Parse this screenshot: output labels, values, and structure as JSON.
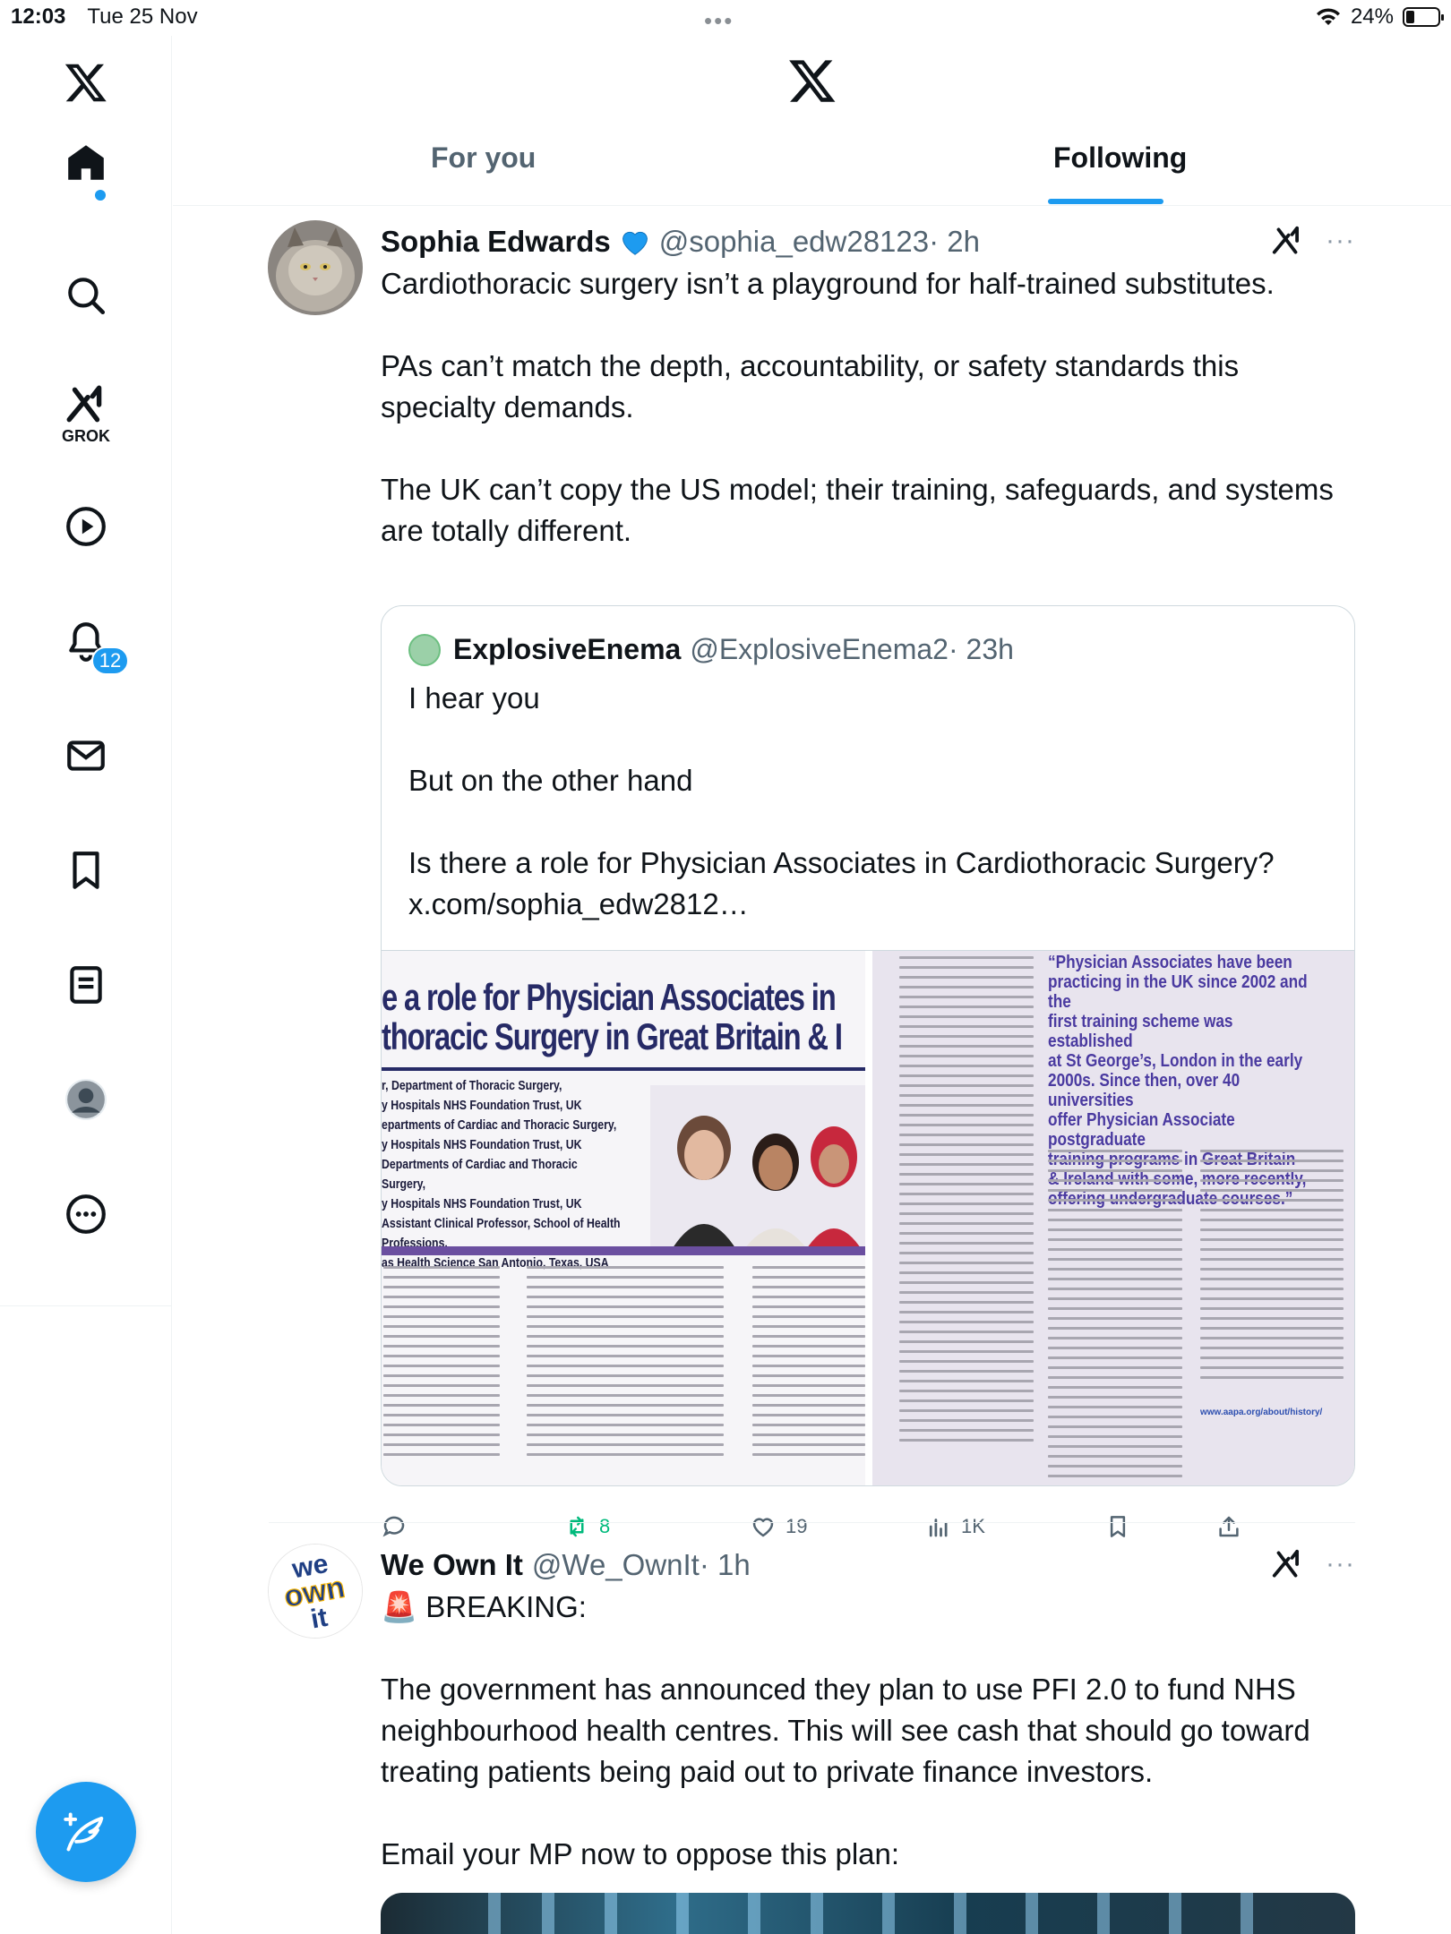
{
  "status_bar": {
    "time": "12:03",
    "date": "Tue 25 Nov",
    "battery": "24%"
  },
  "sidebar": {
    "grok_label": "GROK",
    "notifications_count": "12",
    "items": [
      "x-logo",
      "home-icon",
      "search-icon",
      "grok-icon",
      "video-icon",
      "bell-icon",
      "mail-icon",
      "bookmark-icon",
      "list-icon",
      "profile-icon",
      "more-icon"
    ]
  },
  "header": {
    "tabs": [
      {
        "label": "For you",
        "active": false
      },
      {
        "label": "Following",
        "active": true
      }
    ]
  },
  "tweets": [
    {
      "author": "Sophia Edwards",
      "handle": "@sophia_edw28123",
      "time": "· 2h",
      "text": "Cardiothoracic surgery isn’t a playground for half-trained substitutes.\n\nPAs can’t match the depth, accountability, or safety standards this specialty demands.\n\nThe UK can’t copy the US model; their training, safeguards, and systems are totally different.",
      "quote": {
        "author": "ExplosiveEnema",
        "handle": "@ExplosiveEnema2",
        "time": "· 23h",
        "text": "I hear you\n\nBut on the other hand\n\nIs there a role for Physician Associates in Cardiothoracic Surgery?\nx.com/sophia_edw2812…",
        "media": {
          "article_title_line1": "e a role for Physician Associates in",
          "article_title_line2": "thoracic Surgery in Great Britain & I",
          "affiliations": "r, Department of Thoracic Surgery,\ny Hospitals NHS Foundation Trust, UK\nepartments of Cardiac and Thoracic Surgery,\ny Hospitals NHS Foundation Trust, UK\nDepartments of Cardiac and Thoracic Surgery,\ny Hospitals NHS Foundation Trust, UK\nAssistant Clinical Professor, School of Health Professions,\nas Health Science San Antonio, Texas, USA",
          "pull_quote": "“Physician Associates have been\npracticing in the UK since 2002 and the\nfirst training scheme was established\nat St George’s, London in the early\n2000s. Since then, over 40 universities\noffer Physician Associate postgraduate\ntraining programs in Great Britain\n& Ireland with some, more recently,\noffering undergraduate courses.”",
          "link": "www.aapa.org/about/history/"
        }
      },
      "stats": {
        "replies": "",
        "reposts": "8",
        "likes": "19",
        "views": "1K"
      },
      "colors": {
        "repost_active": "#00ba7c"
      }
    },
    {
      "author": "We Own It",
      "handle": "@We_OwnIt",
      "time": "· 1h",
      "avatar_text": [
        "we",
        "own",
        "it"
      ],
      "text": "🚨 BREAKING:\n\nThe government has announced they plan to use PFI 2.0 to fund NHS neighbourhood health centres. This will see cash that should go toward treating patients being paid out to private finance investors.\n\nEmail your MP now to oppose this plan:"
    }
  ],
  "colors": {
    "accent": "#1d9bf0",
    "text": "#0f1419",
    "secondary": "#536471"
  }
}
